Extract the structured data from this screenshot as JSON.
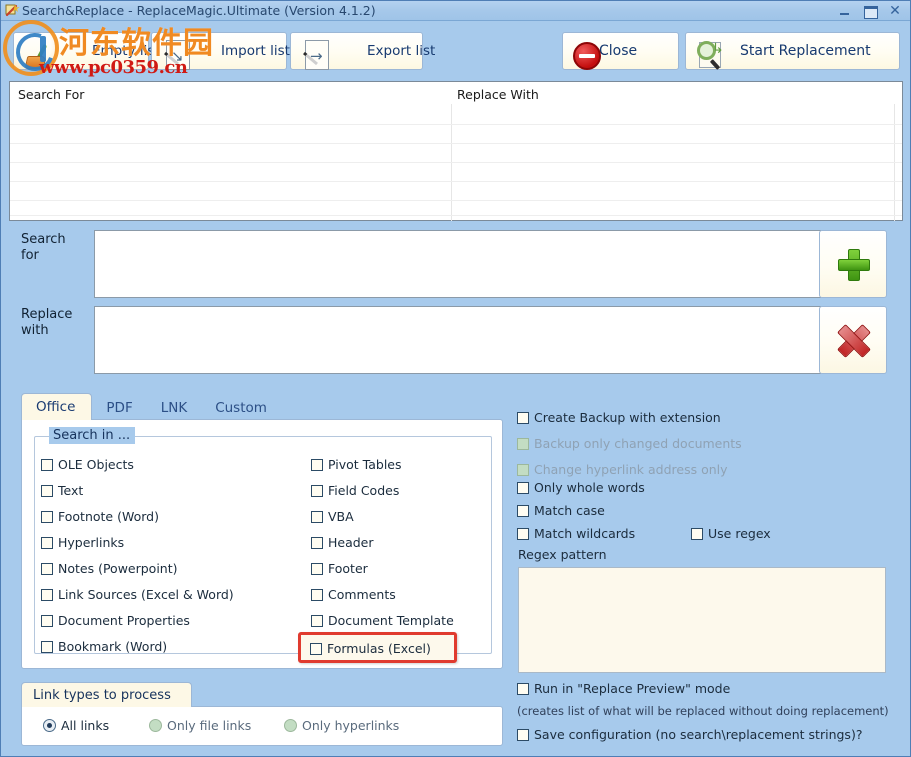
{
  "window": {
    "title": "Search&Replace - ReplaceMagic.Ultimate  (Version 4.1.2)",
    "icon": "wand-icon",
    "minimize_label": "",
    "maximize_label": "",
    "close_label": "✕"
  },
  "watermark": {
    "text_cn": "河东软件园",
    "url": "www.pc0359.cn"
  },
  "toolbar": {
    "empty_list": "Empty list",
    "import_list": "Import list",
    "export_list": "Export list",
    "close": "Close",
    "start_replacement": "Start Replacement"
  },
  "grid": {
    "col_search_for": "Search For",
    "col_replace_with": "Replace With",
    "rows": []
  },
  "fields": {
    "search_for_label": "Search\nfor",
    "search_for_line1": "Search",
    "search_for_line2": "for",
    "search_for_value": "",
    "replace_with_line1": "Replace",
    "replace_with_line2": "with",
    "replace_with_value": "",
    "add_button": "+",
    "delete_button": "✕"
  },
  "tabs": [
    {
      "label": "Office",
      "active": true
    },
    {
      "label": "PDF",
      "active": false
    },
    {
      "label": "LNK",
      "active": false
    },
    {
      "label": "Custom",
      "active": false
    }
  ],
  "search_in": {
    "legend": "Search in ...",
    "left_column": [
      {
        "label": "OLE Objects",
        "checked": false
      },
      {
        "label": "Text",
        "checked": false
      },
      {
        "label": "Footnote (Word)",
        "checked": false
      },
      {
        "label": "Hyperlinks",
        "checked": false
      },
      {
        "label": "Notes (Powerpoint)",
        "checked": false
      },
      {
        "label": "Link Sources (Excel & Word)",
        "checked": false
      },
      {
        "label": "Document Properties",
        "checked": false
      },
      {
        "label": "Bookmark (Word)",
        "checked": false
      }
    ],
    "right_column": [
      {
        "label": "Pivot Tables",
        "checked": false
      },
      {
        "label": "Field Codes",
        "checked": false
      },
      {
        "label": "VBA",
        "checked": false
      },
      {
        "label": "Header",
        "checked": false
      },
      {
        "label": "Footer",
        "checked": false
      },
      {
        "label": "Comments",
        "checked": false
      },
      {
        "label": "Document Template",
        "checked": false
      },
      {
        "label": "Formulas (Excel)",
        "checked": false
      }
    ],
    "highlighted_item": "Formulas (Excel)",
    "highlight_color": "#e03b2f"
  },
  "link_types": {
    "legend": "Link types to process",
    "options": [
      {
        "label": "All links",
        "selected": true,
        "enabled": true
      },
      {
        "label": "Only file links",
        "selected": false,
        "enabled": false
      },
      {
        "label": "Only hyperlinks",
        "selected": false,
        "enabled": false
      }
    ]
  },
  "options": {
    "create_backup": {
      "label": "Create Backup with extension",
      "checked": false,
      "enabled": true
    },
    "backup_changed": {
      "label": "Backup only changed documents",
      "checked": false,
      "enabled": false
    },
    "change_hyperlink": {
      "label": "Change hyperlink address only",
      "checked": false,
      "enabled": false
    },
    "whole_words": {
      "label": "Only whole words",
      "checked": false,
      "enabled": true
    },
    "match_case": {
      "label": "Match case",
      "checked": false,
      "enabled": true
    },
    "match_wildcards": {
      "label": "Match wildcards",
      "checked": false,
      "enabled": true
    },
    "use_regex": {
      "label": "Use regex",
      "checked": false,
      "enabled": true
    },
    "regex_pattern_label": "Regex pattern",
    "regex_pattern_value": "",
    "replace_preview": {
      "label": "Run in \"Replace Preview\" mode",
      "checked": false,
      "enabled": true
    },
    "replace_preview_note": "(creates list of what will be replaced without doing replacement)",
    "save_config": {
      "label": "Save configuration (no search\\replacement strings)?",
      "checked": false,
      "enabled": true
    }
  },
  "colors": {
    "background": "#a7caec",
    "panel": "#ffffff",
    "accent_text": "#1b3c73",
    "field_bg": "#fdf9ec",
    "highlight_red": "#e03b2f"
  }
}
